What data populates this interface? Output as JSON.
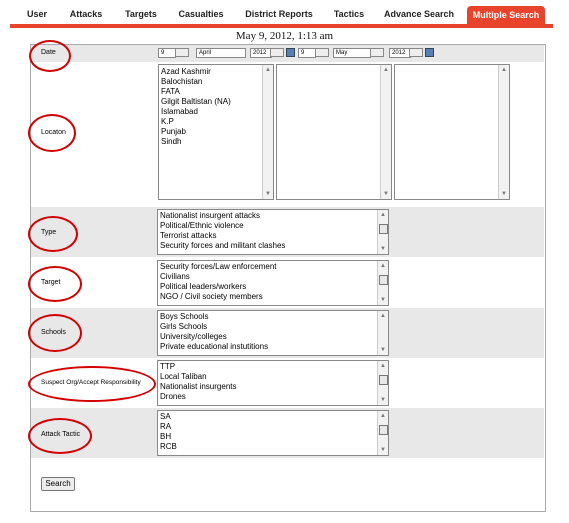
{
  "nav": {
    "tabs": [
      {
        "label": "User"
      },
      {
        "label": "Attacks"
      },
      {
        "label": "Targets"
      },
      {
        "label": "Casualties"
      },
      {
        "label": "District Reports"
      },
      {
        "label": "Tactics"
      },
      {
        "label": "Advance Search"
      },
      {
        "label": "Multiple Search",
        "active": true
      }
    ]
  },
  "header_date": "May 9, 2012, 1:13 am",
  "colors": {
    "accent": "#e8432b",
    "annotation": "#d40000",
    "shade": "#e8e8e8"
  },
  "date_filter": {
    "label": "Date",
    "from": {
      "day": "9",
      "month": "April",
      "year": "2012"
    },
    "to": {
      "day": "9",
      "month": "May",
      "year": "2012"
    }
  },
  "location": {
    "label": "Locaton",
    "options": [
      "Azad Kashmir",
      "Balochistan",
      "FATA",
      "Gilgit Baltistan (NA)",
      "Islamabad",
      "K.P",
      "Punjab",
      "Sindh"
    ]
  },
  "type": {
    "label": "Type",
    "options": [
      "Nationalist insurgent attacks",
      "Political/Ethnic violence",
      "Terrorist attacks",
      "Security forces and militant clashes"
    ]
  },
  "target": {
    "label": "Target",
    "options": [
      "Security forces/Law enforcement",
      "Civilians",
      "Political leaders/workers",
      "NGO / Civil society members"
    ]
  },
  "schools": {
    "label": "Schools",
    "options": [
      "Boys Schools",
      "Girls Schools",
      "University/colleges",
      "Private educational instutitions"
    ]
  },
  "suspect": {
    "label": "Suspect Org/Accept Responsibility",
    "options": [
      "TTP",
      "Local Taliban",
      "Nationalist insurgents",
      "Drones"
    ]
  },
  "tactic": {
    "label": "Attack Tactic",
    "options": [
      "SA",
      "RA",
      "BH",
      "RCB"
    ]
  },
  "search_button": "Search",
  "icons": {
    "calendar": "calendar-icon",
    "scroll_up": "▲",
    "scroll_down": "▼"
  }
}
